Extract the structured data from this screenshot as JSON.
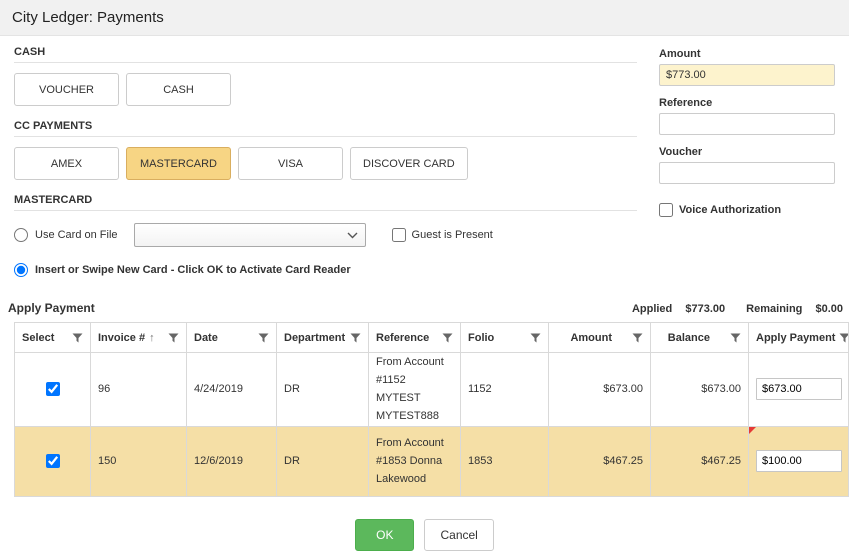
{
  "title": "City Ledger: Payments",
  "cash_section": {
    "label": "CASH",
    "buttons": [
      "VOUCHER",
      "CASH"
    ]
  },
  "cc_section": {
    "label": "CC PAYMENTS",
    "buttons": [
      "AMEX",
      "MASTERCARD",
      "VISA",
      "DISCOVER CARD"
    ],
    "selected": "MASTERCARD"
  },
  "mastercard_section": {
    "label": "MASTERCARD",
    "use_card_on_file_label": "Use Card on File",
    "use_card_on_file_selected": false,
    "card_on_file_value": "",
    "guest_is_present_label": "Guest is Present",
    "guest_is_present_checked": false,
    "insert_swipe_label": "Insert or Swipe New Card - Click OK to Activate Card Reader",
    "insert_swipe_selected": true
  },
  "right_panel": {
    "amount_label": "Amount",
    "amount_value": "$773.00",
    "reference_label": "Reference",
    "reference_value": "",
    "voucher_label": "Voucher",
    "voucher_value": "",
    "voice_authorization_label": "Voice Authorization",
    "voice_authorization_checked": false
  },
  "apply_payment_bar": {
    "label": "Apply Payment",
    "applied_label": "Applied",
    "applied_value": "$773.00",
    "remaining_label": "Remaining",
    "remaining_value": "$0.00"
  },
  "table": {
    "columns": [
      "Select",
      "Invoice #",
      "Date",
      "Department",
      "Reference",
      "Folio",
      "Amount",
      "Balance",
      "Apply Payment"
    ],
    "sort_indicator": "↑",
    "rows": [
      {
        "selected": true,
        "invoice": "96",
        "date": "4/24/2019",
        "department": "DR",
        "reference": "From Account #1152 MYTEST MYTEST888",
        "folio": "1152",
        "amount": "$673.00",
        "balance": "$673.00",
        "apply_payment": "$673.00",
        "modified": false
      },
      {
        "selected": true,
        "invoice": "150",
        "date": "12/6/2019",
        "department": "DR",
        "reference": "From Account #1853 Donna Lakewood",
        "folio": "1853",
        "amount": "$467.25",
        "balance": "$467.25",
        "apply_payment": "$100.00",
        "modified": true
      }
    ]
  },
  "footer": {
    "ok_label": "OK",
    "cancel_label": "Cancel"
  },
  "colors": {
    "selected_button_bg": "#f7d584",
    "highlight_row_bg": "#f5dfa6",
    "amount_input_bg": "#fdf3cd",
    "ok_green": "#5cb85c",
    "modified_marker": "#e53935"
  }
}
